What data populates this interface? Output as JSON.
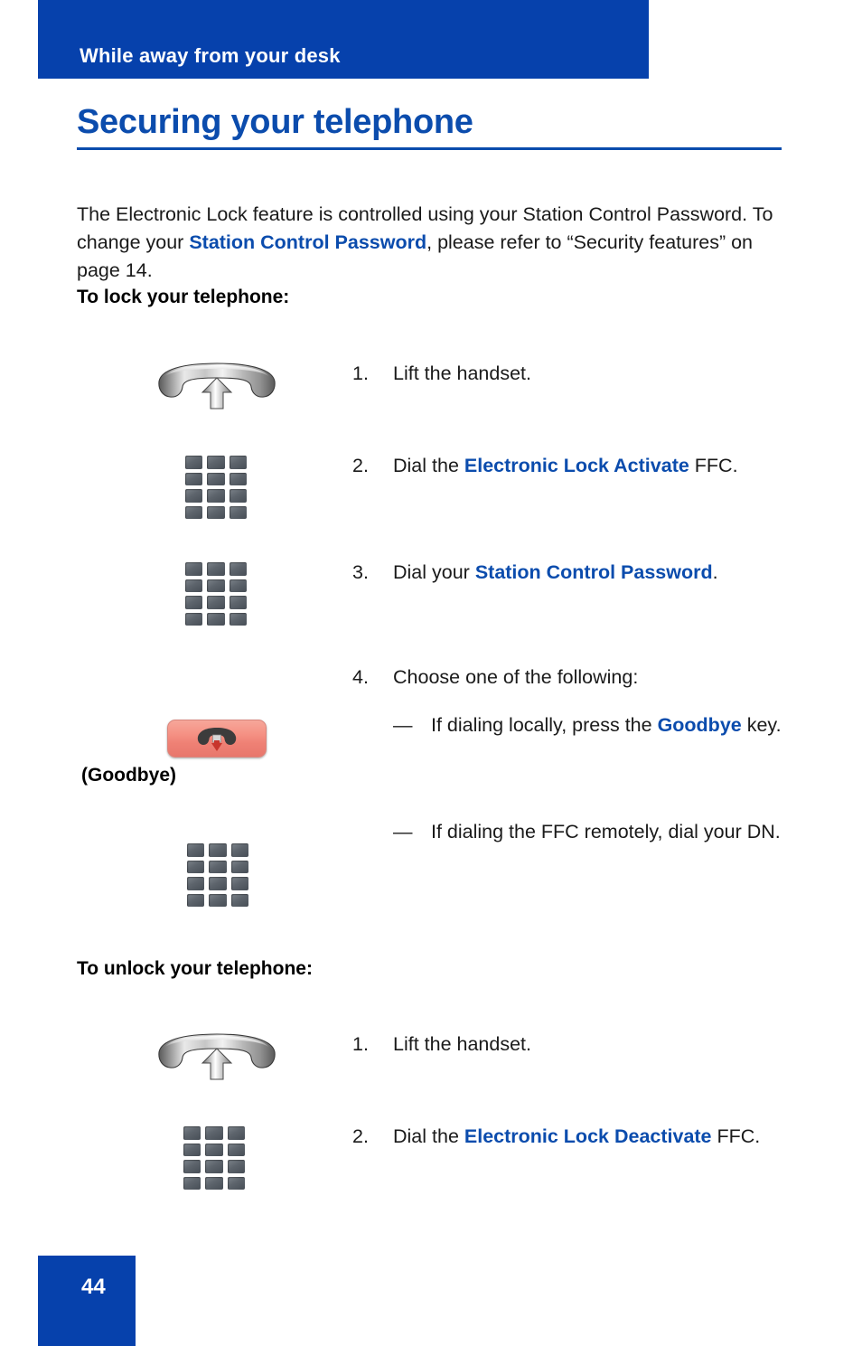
{
  "header": {
    "running_head": "While away from your desk",
    "band_color": "#0641ac"
  },
  "title": {
    "text": "Securing your telephone",
    "color": "#0b4cad"
  },
  "intro": {
    "part1": "The Electronic Lock feature is controlled using your Station Control Password. To change your ",
    "emphasis": "Station Control Password",
    "part2": ", please refer to “Security features” on page 14."
  },
  "sections": [
    {
      "heading": "To lock your telephone:",
      "steps": [
        {
          "number": "1.",
          "icon": "handset-lift-icon",
          "text_before": "Lift the handset.",
          "emphasis": "",
          "text_after": ""
        },
        {
          "number": "2.",
          "icon": "keypad-icon",
          "text_before": "Dial the ",
          "emphasis": "Electronic Lock Activate",
          "text_after": " FFC."
        },
        {
          "number": "3.",
          "icon": "keypad-icon",
          "text_before": "Dial your ",
          "emphasis": "Station Control Password",
          "text_after": "."
        },
        {
          "number": "4.",
          "icon": "",
          "text_before": "Choose one of the following:",
          "emphasis": "",
          "text_after": ""
        }
      ],
      "substeps": [
        {
          "dash": "—",
          "icon": "goodbye-key-icon",
          "icon_label": "(Goodbye)",
          "text_before": "If dialing locally, press the ",
          "emphasis": "Goodbye",
          "text_after": " key."
        },
        {
          "dash": "—",
          "icon": "keypad-icon",
          "icon_label": "",
          "text_before": "If dialing the FFC remotely, dial your DN.",
          "emphasis": "",
          "text_after": ""
        }
      ]
    },
    {
      "heading": "To unlock your telephone:",
      "steps": [
        {
          "number": "1.",
          "icon": "handset-lift-icon",
          "text_before": "Lift the handset.",
          "emphasis": "",
          "text_after": ""
        },
        {
          "number": "2.",
          "icon": "keypad-icon",
          "text_before": "Dial the ",
          "emphasis": "Electronic Lock Deactivate",
          "text_after": " FFC."
        }
      ],
      "substeps": []
    }
  ],
  "footer": {
    "page_number": "44",
    "box_color": "#0641ac"
  }
}
